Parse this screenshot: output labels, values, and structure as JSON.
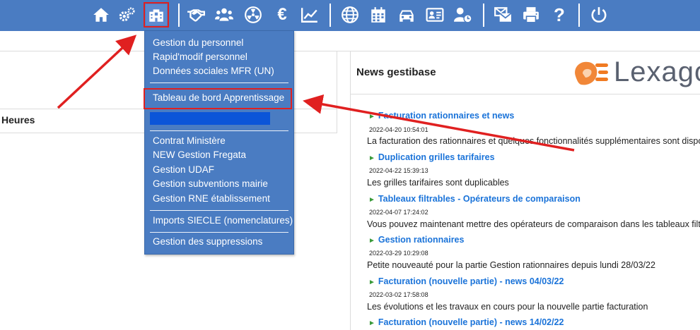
{
  "toolbar": {
    "icons": [
      "home-icon",
      "gears-icon",
      "building-icon",
      "handshake-icon",
      "users-icon",
      "radiation-icon",
      "euro-icon",
      "chart-line-icon",
      "globe-icon",
      "calendar-icon",
      "car-icon",
      "id-card-icon",
      "user-clock-icon",
      "mail-icon",
      "printer-icon",
      "help-icon",
      "power-icon"
    ],
    "euro_glyph": "€",
    "help_glyph": "?"
  },
  "dropdown": {
    "group1": [
      "Gestion du personnel",
      "Rapid'modif personnel",
      "Données sociales MFR (UN)"
    ],
    "highlighted": "Tableau de bord Apprentissage",
    "group3": [
      "Contrat Ministère",
      "NEW Gestion Fregata",
      "Gestion UDAF",
      "Gestion subventions mairie",
      "Gestion RNE établissement"
    ],
    "group4": [
      "Imports SIECLE (nomenclatures)"
    ],
    "group5": [
      "Gestion des suppressions"
    ]
  },
  "left": {
    "heures_label": "Heures"
  },
  "news": {
    "header": "News gestibase",
    "logo_text": "Lexago",
    "items": [
      {
        "title": "Facturation rationnaires et news",
        "date": "2022-04-20 10:54:01",
        "desc": "La facturation des rationnaires et quelques fonctionnalités supplémentaires sont disponi"
      },
      {
        "title": "Duplication grilles tarifaires",
        "date": "2022-04-22 15:39:13",
        "desc": "Les grilles tarifaires sont duplicables"
      },
      {
        "title": "Tableaux filtrables - Opérateurs de comparaison",
        "date": "2022-04-07 17:24:02",
        "desc": "Vous pouvez maintenant mettre des opérateurs de comparaison dans les tableaux filtrab"
      },
      {
        "title": "Gestion rationnaires",
        "date": "2022-03-29 10:29:08",
        "desc": "Petite nouveauté pour la partie Gestion rationnaires depuis lundi 28/03/22"
      },
      {
        "title": "Facturation (nouvelle partie) - news 04/03/22",
        "date": "2022-03-02 17:58:08",
        "desc": "Les évolutions et les travaux en cours pour la nouvelle partie facturation"
      },
      {
        "title": "Facturation (nouvelle partie) - news 14/02/22",
        "date": "",
        "desc": ""
      }
    ]
  },
  "colors": {
    "topbar": "#4a7cc2",
    "menu_bg": "#4a7cc2",
    "link": "#1a73d9",
    "annotation": "#e02020",
    "bullet": "#3a9a3a",
    "logo_orange": "#f07a22"
  }
}
